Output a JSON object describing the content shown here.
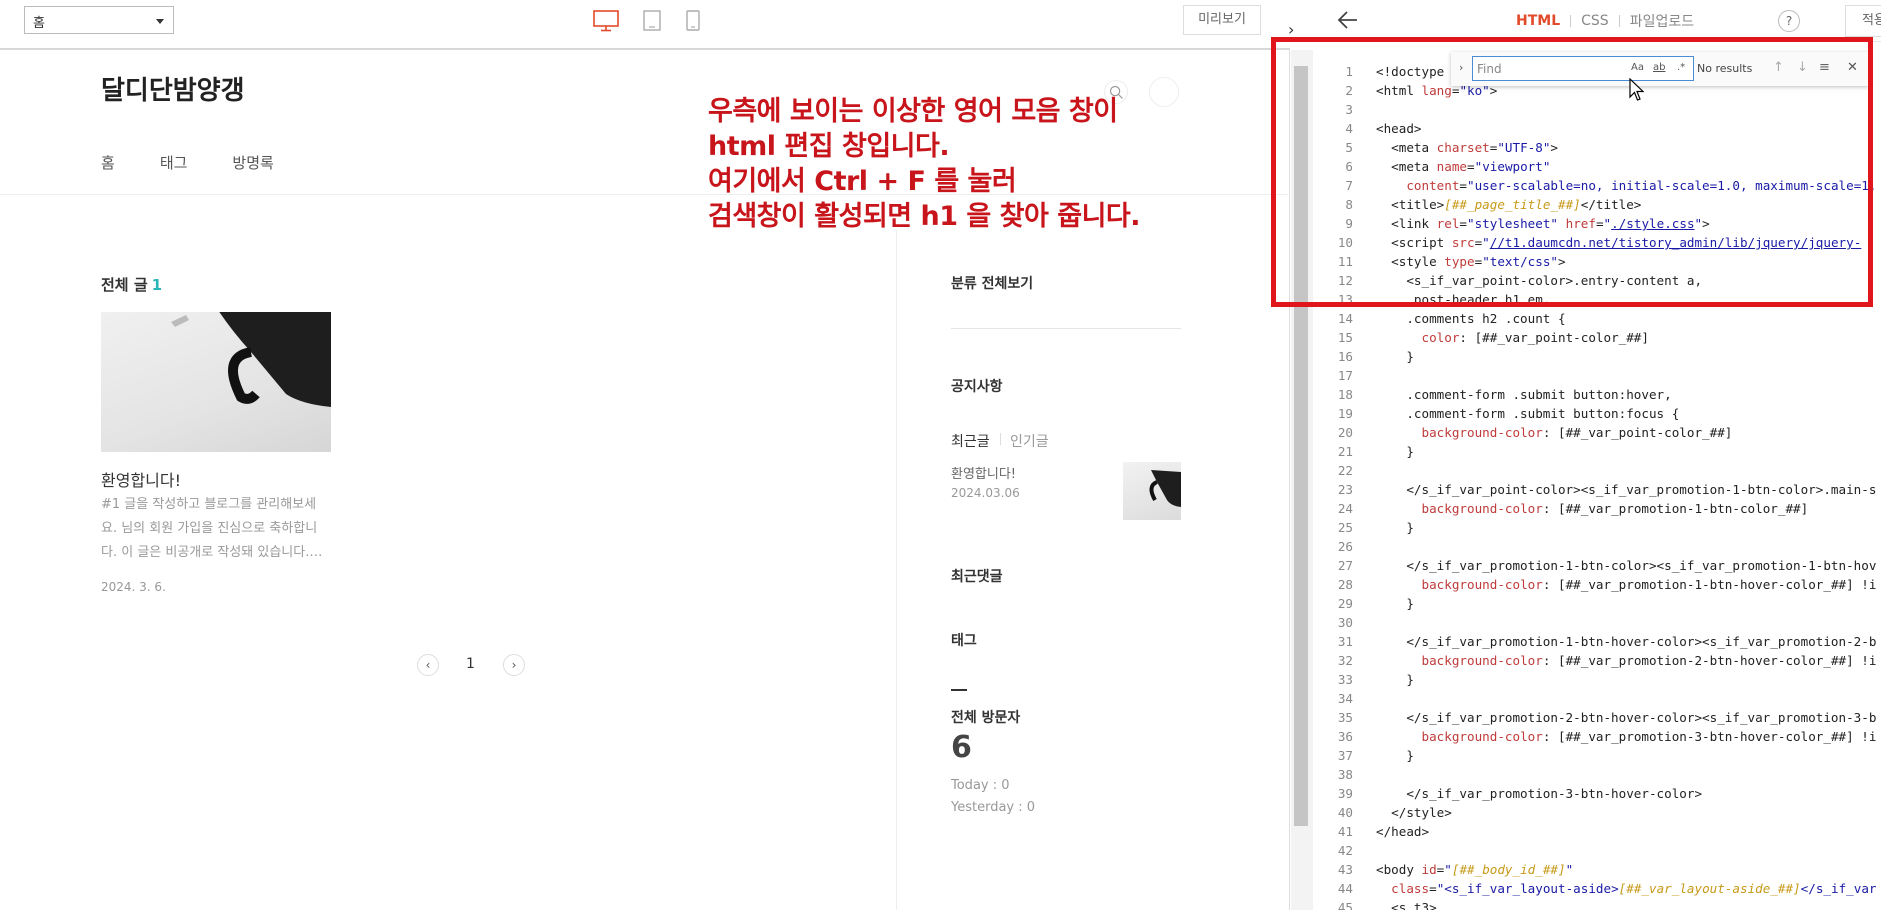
{
  "preview": {
    "page_select": "홈",
    "preview_button": "미리보기",
    "blog": {
      "title": "달디단밤양갱",
      "nav": [
        "홈",
        "태그",
        "방명록"
      ]
    },
    "posts": {
      "heading": "전체 글",
      "count": "1",
      "items": [
        {
          "title": "환영합니다!",
          "excerpt": "#1 글을 작성하고 블로그를 관리해보세요. 님의 회원 가입을 진심으로 축하합니다. 이 글은 비공개로 작성돼 있습니다.…",
          "date": "2024. 3. 6."
        }
      ]
    },
    "pager": {
      "prev": "‹",
      "page": "1",
      "next": "›"
    },
    "sidebar": {
      "categories": "분류 전체보기",
      "notice": "공지사항",
      "tab_recent": "최근글",
      "tab_popular": "인기글",
      "recent_title": "환영합니다!",
      "recent_date": "2024.03.06",
      "comments": "최근댓글",
      "tags": "태그",
      "visitors_label": "전체 방문자",
      "visitors_count": "6",
      "today": "Today : 0",
      "yesterday": "Yesterday : 0"
    }
  },
  "annotation": {
    "lines": [
      "우측에 보이는 이상한 영어 모음 창이",
      "html 편집 창입니다.",
      "여기에서 Ctrl + F 를 눌러",
      "검색창이 활성되면 h1 을 찾아 줍니다."
    ],
    "color": "#c8151b"
  },
  "editor": {
    "tabs": {
      "html": "HTML",
      "css": "CSS",
      "upload": "파일업로드"
    },
    "help": "?",
    "apply_button": "적용",
    "find": {
      "placeholder": "Find",
      "case_option": "Aa",
      "word_option": "ab",
      "regex_option": ".*",
      "result": "No results"
    },
    "accent_color": "#e24a2a",
    "highlight_color": "#e0161c"
  }
}
